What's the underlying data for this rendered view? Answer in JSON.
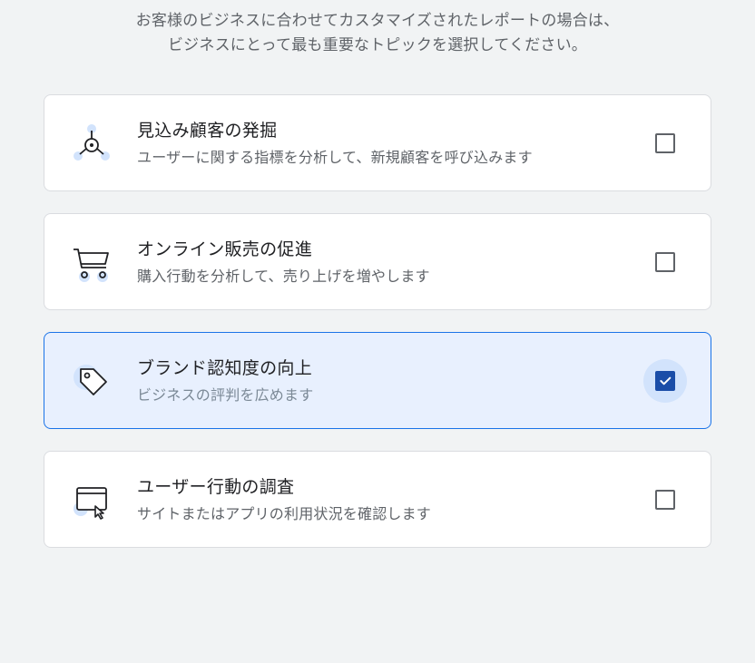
{
  "intro": {
    "line1": "お客様のビジネスに合わせてカスタマイズされたレポートの場合は、",
    "line2": "ビジネスにとって最も重要なトピックを選択してください。"
  },
  "options": [
    {
      "title": "見込み顧客の発掘",
      "desc": "ユーザーに関する指標を分析して、新規顧客を呼び込みます",
      "selected": false
    },
    {
      "title": "オンライン販売の促進",
      "desc": "購入行動を分析して、売り上げを増やします",
      "selected": false
    },
    {
      "title": "ブランド認知度の向上",
      "desc": "ビジネスの評判を広めます",
      "selected": true
    },
    {
      "title": "ユーザー行動の調査",
      "desc": "サイトまたはアプリの利用状況を確認します",
      "selected": false
    }
  ]
}
